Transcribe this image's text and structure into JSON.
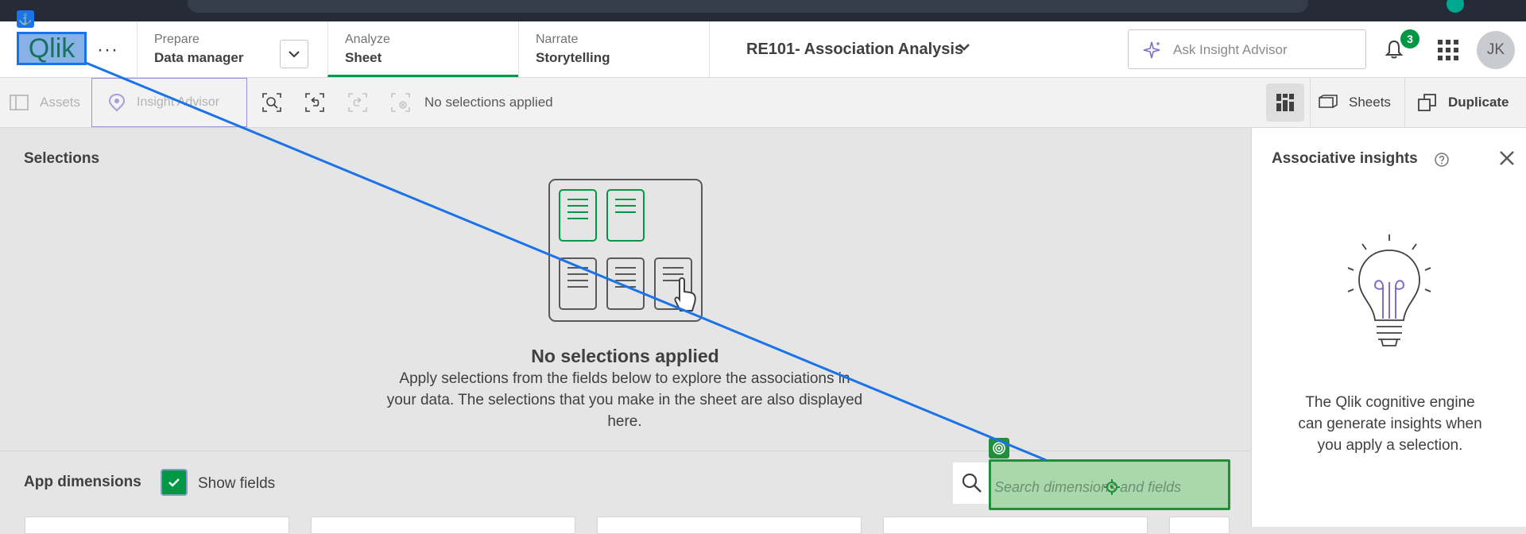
{
  "header": {
    "logo_text": "Qlik",
    "more_icon": "more-horizontal-icon",
    "nav": [
      {
        "small": "Prepare",
        "big": "Data manager"
      },
      {
        "small": "Analyze",
        "big": "Sheet"
      },
      {
        "small": "Narrate",
        "big": "Storytelling"
      }
    ],
    "app_name": "RE101- Association Analysis",
    "ask_placeholder": "Ask Insight Advisor",
    "notification_count": "3",
    "user_initials": "JK"
  },
  "toolbar": {
    "assets": "Assets",
    "insight_advisor": "Insight Advisor",
    "selections_status": "No selections applied",
    "sheets": "Sheets",
    "duplicate": "Duplicate"
  },
  "selections": {
    "title": "Selections",
    "empty_title": "No selections applied",
    "empty_desc": "Apply selections from the fields below to explore the associations in your data. The selections that you make in the sheet are also displayed here."
  },
  "dimensions": {
    "title": "App dimensions",
    "show_fields_label": "Show fields",
    "show_fields_checked": true,
    "search_placeholder": "Search dimensions and fields"
  },
  "insights_panel": {
    "title": "Associative insights",
    "body": "The Qlik cognitive engine can generate insights when you apply a selection."
  },
  "colors": {
    "accent_green": "#009845",
    "annotation_blue": "#1a73e8",
    "annotation_green": "#1f8f3b",
    "insight_purple": "#9a8fd4"
  }
}
